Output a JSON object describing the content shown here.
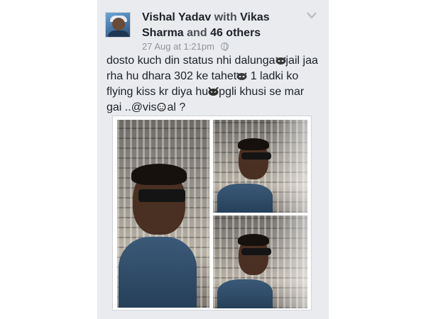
{
  "post": {
    "author_name": "Vishal Yadav",
    "with_word": "with",
    "tagged_first": "Vikas Sharma",
    "and_word": "and",
    "others": "46 others",
    "timestamp": "27 Aug at 1:21pm",
    "privacy_icon": "globe-icon",
    "menu_icon": "chevron-down-icon",
    "text_parts": [
      "dosto kuch din status nhi dalunga",
      "jail jaa rha hu dhara 302 ke tahet",
      "1 ladki ko flying kiss kr diya hu",
      "pgli khusi se mar gai ..@vis",
      "al ?"
    ],
    "emoji_icons": [
      "mischief-emoji-icon",
      "mischief-emoji-icon",
      "devil-emoji-icon",
      "smiley-emoji-icon"
    ],
    "photos": [
      "photo-main",
      "photo-top-right",
      "photo-bottom-right"
    ]
  },
  "colors": {
    "card_bg": "#e9ebee",
    "author_text": "#1d2129",
    "meta_text": "#90949c"
  }
}
